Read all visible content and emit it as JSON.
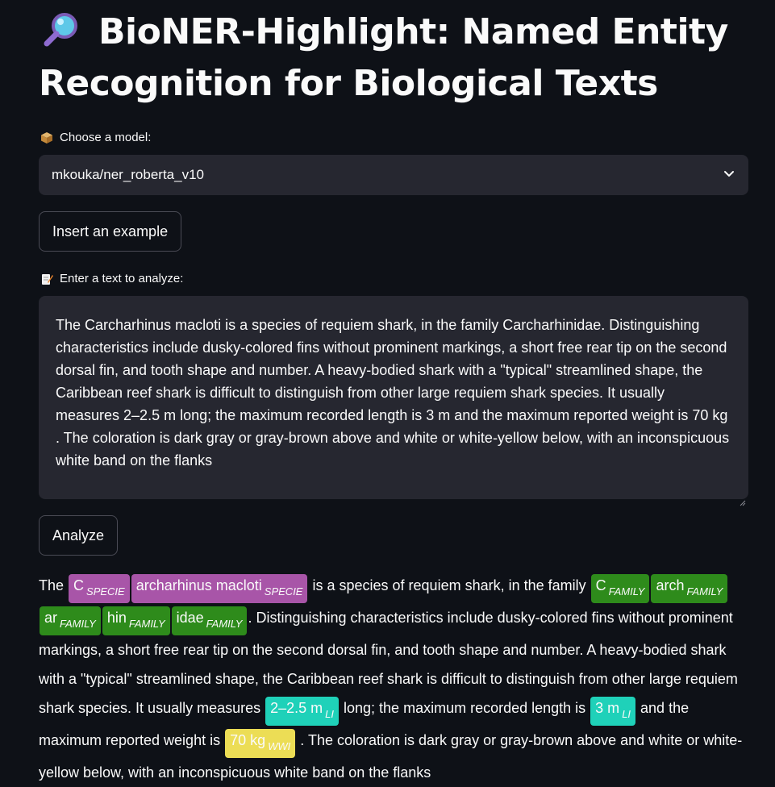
{
  "header": {
    "title_icon": "magnifying-glass-icon",
    "title": "BioNER-Highlight: Named Entity Recognition for Biological Texts"
  },
  "model": {
    "label_icon": "package-icon",
    "label": "Choose a model:",
    "selected": "mkouka/ner_roberta_v10"
  },
  "buttons": {
    "example": "Insert an example",
    "analyze": "Analyze"
  },
  "input": {
    "label_icon": "memo-icon",
    "label": "Enter a text to analyze:",
    "value": "The Carcharhinus macloti is a species of requiem shark, in the family Carcharhinidae. Distinguishing characteristics include dusky-colored fins without prominent markings, a short free rear tip on the second dorsal fin, and tooth shape and number. A heavy-bodied shark with a \"typical\" streamlined shape, the Caribbean reef shark is difficult to distinguish from other large requiem shark species. It usually measures 2–2.5 m  long; the maximum recorded length is 3 m and the maximum reported weight is 70 kg . The coloration is dark gray or gray-brown above and white or white-yellow below, with an inconspicuous white band on the flanks"
  },
  "colors": {
    "SPECIE": "#a855a8",
    "FAMILY": "#2e8b1b",
    "LI": "#1fd1b9",
    "WWI": "#ecdd55"
  },
  "result": {
    "segments": [
      {
        "type": "text",
        "text": "The "
      },
      {
        "type": "ent",
        "text": "C",
        "label": "SPECIE"
      },
      {
        "type": "ent",
        "text": "archarhinus macloti",
        "label": "SPECIE"
      },
      {
        "type": "text",
        "text": " is a species of requiem shark, in the family "
      },
      {
        "type": "ent",
        "text": "C",
        "label": "FAMILY"
      },
      {
        "type": "ent",
        "text": "arch",
        "label": "FAMILY"
      },
      {
        "type": "ent",
        "text": "ar",
        "label": "FAMILY"
      },
      {
        "type": "ent",
        "text": "hin",
        "label": "FAMILY"
      },
      {
        "type": "ent",
        "text": "idae",
        "label": "FAMILY"
      },
      {
        "type": "text",
        "text": ". Distinguishing characteristics include dusky-colored fins without prominent markings, a short free rear tip on the second dorsal fin, and tooth shape and number. A heavy-bodied shark with a \"typical\" streamlined shape, the Caribbean reef shark is difficult to distinguish from other large requiem shark species. It usually measures "
      },
      {
        "type": "ent",
        "text": "2–2.5 m",
        "label": "LI"
      },
      {
        "type": "text",
        "text": " long; the maximum recorded length is "
      },
      {
        "type": "ent",
        "text": "3 m",
        "label": "LI"
      },
      {
        "type": "text",
        "text": " and the maximum reported weight is "
      },
      {
        "type": "ent",
        "text": "70 kg",
        "label": "WWI"
      },
      {
        "type": "text",
        "text": " . The coloration is dark gray or gray-brown above and white or white-yellow below, with an inconspicuous white band on the flanks"
      }
    ]
  }
}
